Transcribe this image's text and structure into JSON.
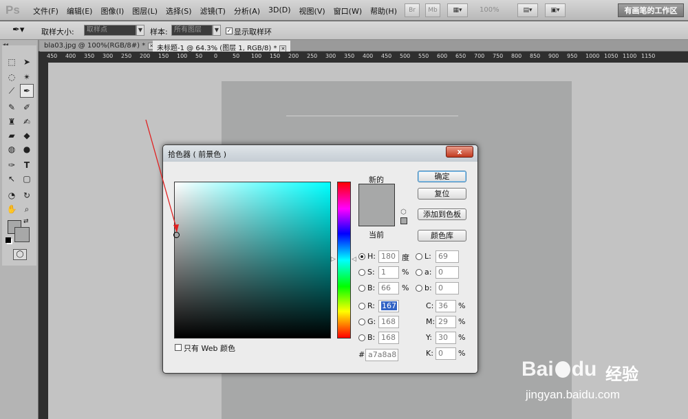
{
  "app": {
    "logo": "Ps"
  },
  "menu": [
    "文件(F)",
    "编辑(E)",
    "图像(I)",
    "图层(L)",
    "选择(S)",
    "滤镜(T)",
    "分析(A)",
    "3D(D)",
    "视图(V)",
    "窗口(W)",
    "帮助(H)"
  ],
  "appbar": {
    "br_label": "Br",
    "mb_label": "Mb",
    "zoom": "100%",
    "workspace": "有画笔的工作区"
  },
  "options": {
    "sample_size_label": "取样大小:",
    "sample_size_value": "取样点",
    "sample_label": "样本:",
    "sample_value": "所有图层",
    "show_ring_label": "显示取样环",
    "show_ring_checked": true
  },
  "tabs": [
    {
      "label": "bla03.jpg @ 100%(RGB/8#) *"
    },
    {
      "label": "未标题-1 @ 64.3% (图层 1, RGB/8) *"
    }
  ],
  "ruler_ticks": [
    "450",
    "400",
    "350",
    "300",
    "250",
    "200",
    "150",
    "100",
    "50",
    "0",
    "50",
    "100",
    "150",
    "200",
    "250",
    "300",
    "350",
    "400",
    "450",
    "500",
    "550",
    "600",
    "650",
    "700",
    "750",
    "800",
    "850",
    "900",
    "950",
    "1000",
    "1050",
    "1100",
    "1150"
  ],
  "dialog": {
    "title": "拾色器 ( 前景色 )",
    "close_glyph": "x",
    "new_label": "新的",
    "current_label": "当前",
    "buttons": {
      "ok": "确定",
      "reset": "复位",
      "add_swatch": "添加到色板",
      "libraries": "颜色库"
    },
    "web_only_label": "只有 Web 颜色",
    "web_only_checked": false,
    "hsb": [
      {
        "label": "H:",
        "value": "180",
        "unit": "度",
        "selected": true
      },
      {
        "label": "S:",
        "value": "1",
        "unit": "%",
        "selected": false
      },
      {
        "label": "B:",
        "value": "66",
        "unit": "%",
        "selected": false
      }
    ],
    "rgb": [
      {
        "label": "R:",
        "value": "167",
        "selected": false
      },
      {
        "label": "G:",
        "value": "168",
        "selected": false
      },
      {
        "label": "B:",
        "value": "168",
        "selected": false
      }
    ],
    "lab": [
      {
        "label": "L:",
        "value": "69"
      },
      {
        "label": "a:",
        "value": "0"
      },
      {
        "label": "b:",
        "value": "0"
      }
    ],
    "cmyk": [
      {
        "label": "C:",
        "value": "36",
        "unit": "%"
      },
      {
        "label": "M:",
        "value": "29",
        "unit": "%"
      },
      {
        "label": "Y:",
        "value": "30",
        "unit": "%"
      },
      {
        "label": "K:",
        "value": "0",
        "unit": "%"
      }
    ],
    "hex_label": "#",
    "hex_value": "a7a8a8",
    "color": "#a7a8a8"
  },
  "watermark": {
    "line1": "Bai",
    "line2": "du",
    "line3": "经验",
    "line4": "jingyan.baidu.com"
  }
}
